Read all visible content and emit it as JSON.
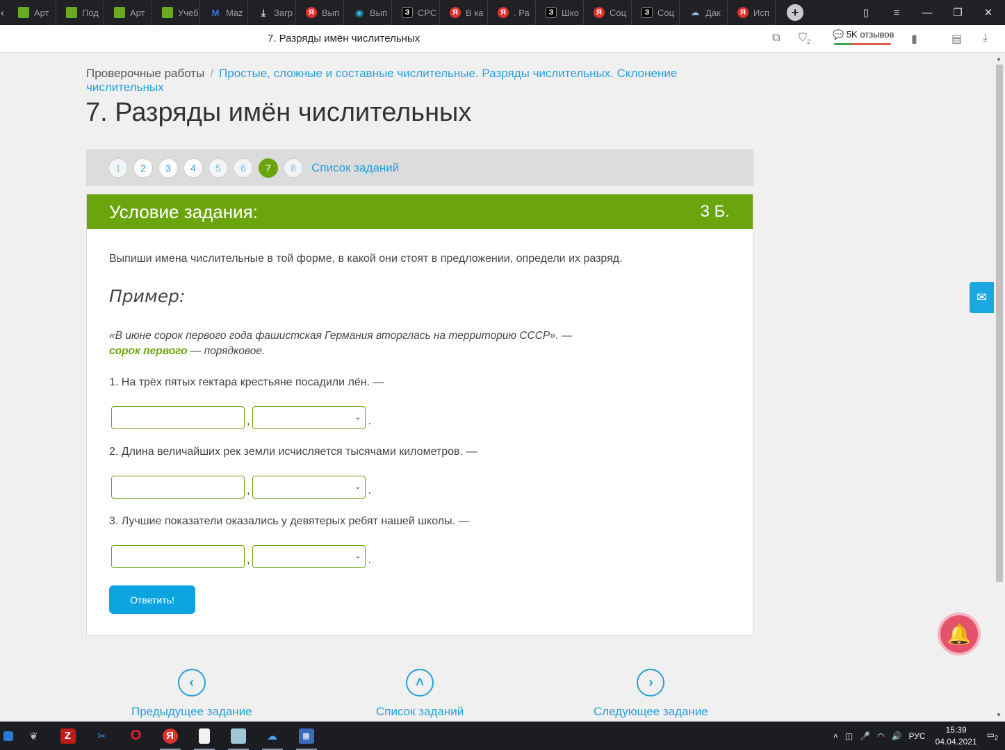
{
  "browser": {
    "tabs": [
      {
        "title": "Арт",
        "icon": "book-icon"
      },
      {
        "title": "Под",
        "icon": "book-icon"
      },
      {
        "title": "Арт",
        "icon": "book-icon"
      },
      {
        "title": "Учеб",
        "icon": "book-icon"
      },
      {
        "title": "Maz",
        "icon": "m-logo-icon"
      },
      {
        "title": "Загр",
        "icon": "download-icon"
      },
      {
        "title": "Вып",
        "icon": "yandex-icon"
      },
      {
        "title": "Вып",
        "icon": "bulb-icon"
      },
      {
        "title": "СРС",
        "icon": "z-logo-icon"
      },
      {
        "title": "В ка",
        "icon": "yandex-icon"
      },
      {
        "title": ". Ра",
        "icon": "yandex-icon"
      },
      {
        "title": "Шко",
        "icon": "z-logo-icon"
      },
      {
        "title": "Соц",
        "icon": "yandex-icon"
      },
      {
        "title": "Соц",
        "icon": "z-logo-icon"
      },
      {
        "title": "Дак",
        "icon": "cloud-icon"
      },
      {
        "title": "Исп",
        "icon": "yandex-icon"
      }
    ],
    "page_title": "7. Разряды имён числительных",
    "reviews": "5K отзывов",
    "badge_count": "2"
  },
  "breadcrumb": {
    "root": "Проверочные работы",
    "separator": "/",
    "current": "Простые, сложные и составные числительные. Разряды числительных. Склонение числительных"
  },
  "title": "7. Разряды имён числительных",
  "pager": {
    "pages": [
      "1",
      "2",
      "3",
      "4",
      "5",
      "6",
      "7",
      "8"
    ],
    "active": "7",
    "list_link": "Список заданий"
  },
  "task": {
    "heading": "Условие задания:",
    "points": "3 Б.",
    "instruction": "Выпиши имена числительные в той форме, в какой они стоят в предложении, определи их разряд.",
    "example_heading": "Пример:",
    "example_sentence": "«В июне сорок первого года фашистская Германия вторглась на территорию СССР». —",
    "example_answer": "сорок первого",
    "example_answer_tail": " — порядковое.",
    "questions": [
      {
        "text": "1. На трёх пятых гектара крестьяне посадили лён. —",
        "input_value": "",
        "select_value": ""
      },
      {
        "text": "2. Длина величайших рек земли исчисляется тысячами километров. —",
        "input_value": "",
        "select_value": ""
      },
      {
        "text": "3. Лучшие показатели оказались у девятерых ребят нашей школы. —",
        "input_value": "",
        "select_value": ""
      }
    ],
    "comma": ",",
    "period": ".",
    "submit_label": "Ответить!"
  },
  "navigation": {
    "prev_label": "Предыдущее задание",
    "list_label": "Список заданий",
    "next_label": "Следующее задание"
  },
  "taskbar": {
    "language": "РУС",
    "time": "15:39",
    "date": "04.04.2021",
    "notifications": "2"
  },
  "colors": {
    "accent_green": "#6aa50d",
    "link_blue": "#29a0d8",
    "button_blue": "#0ba4e0"
  }
}
